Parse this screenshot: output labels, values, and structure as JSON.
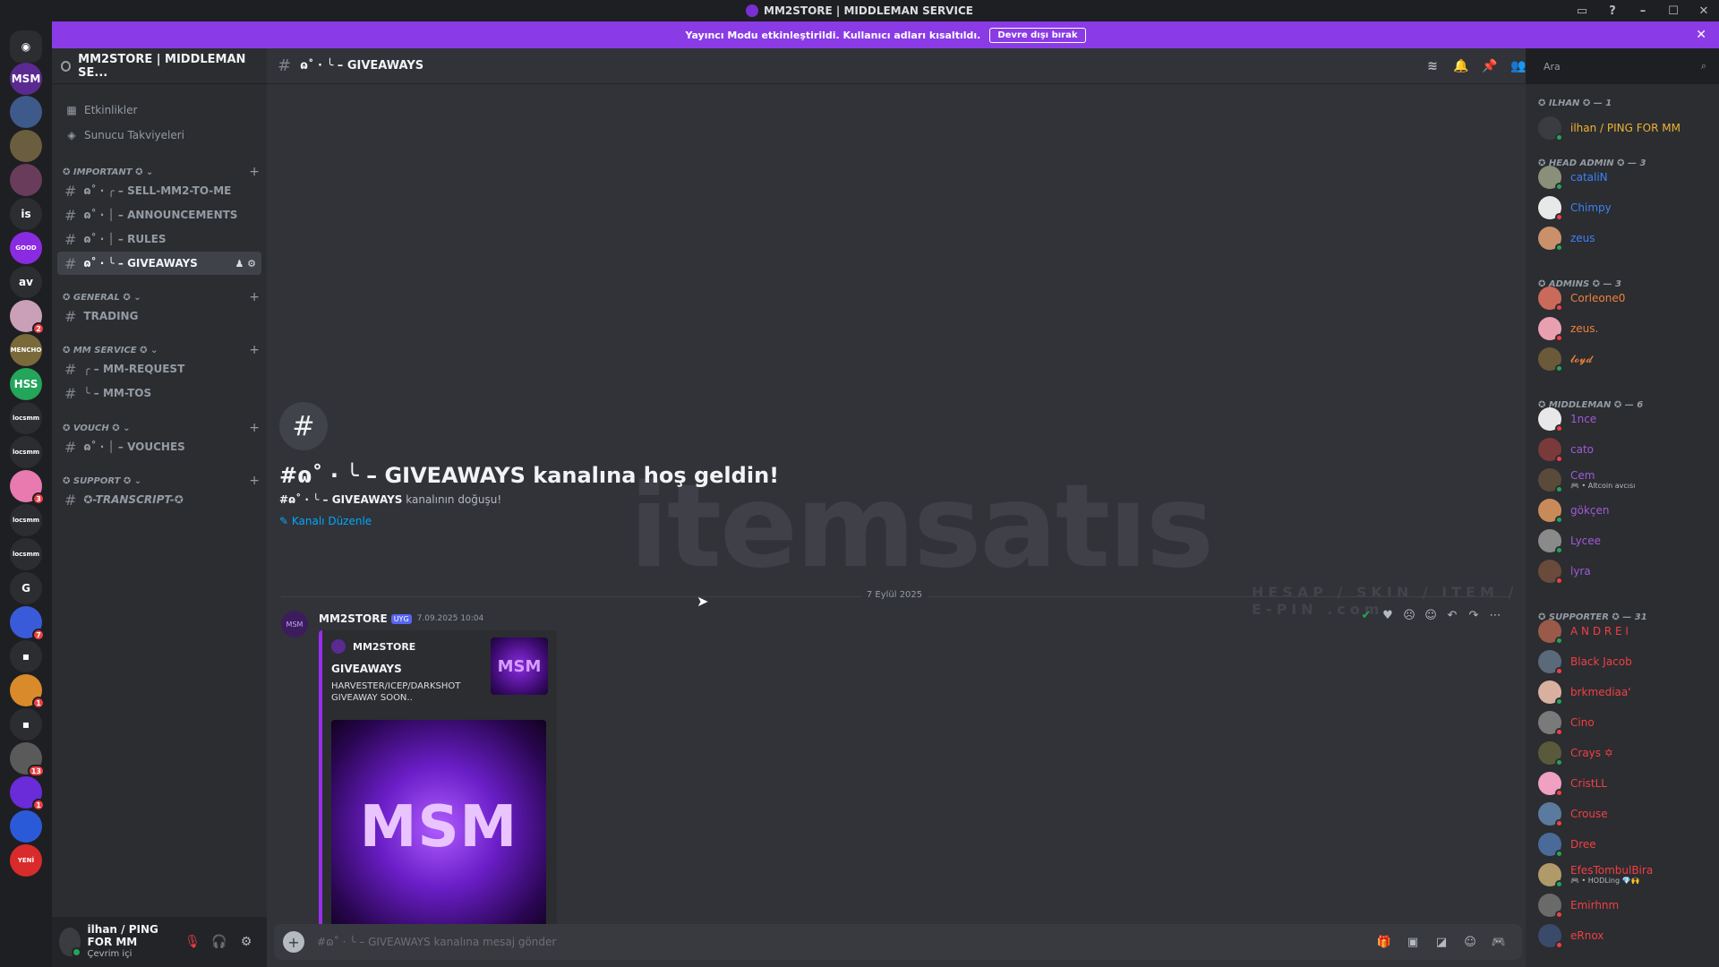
{
  "titlebar": {
    "title": "MM2STORE | MIDDLEMAN SERVICE",
    "minimize": "–",
    "maximize": "☐",
    "close": "✕"
  },
  "banner": {
    "text": "Yayıncı Modu etkinleştirildi. Kullanıcı adları kısaltıldı.",
    "button": "Devre dışı bırak",
    "close": "✕"
  },
  "guilds": [
    {
      "label": "MSM",
      "bg": "#5b2a91",
      "badge": ""
    },
    {
      "label": "",
      "bg": "#3d5a8a",
      "badge": ""
    },
    {
      "label": "",
      "bg": "#6b5e3e",
      "badge": ""
    },
    {
      "label": "",
      "bg": "#6a3c5c",
      "badge": ""
    },
    {
      "label": "is",
      "bg": "#2b2d31",
      "badge": ""
    },
    {
      "label": "GOOD",
      "bg": "#8a2be2",
      "badge": ""
    },
    {
      "label": "av",
      "bg": "#2b2d31",
      "badge": ""
    },
    {
      "label": "",
      "bg": "#c9a0b8",
      "badge": "2"
    },
    {
      "label": "MENCHO",
      "bg": "#7a6a3a",
      "badge": ""
    },
    {
      "label": "HSS",
      "bg": "#23a55a",
      "badge": ""
    },
    {
      "label": "locsmm",
      "bg": "#2b2d31",
      "badge": ""
    },
    {
      "label": "locsmm",
      "bg": "#2b2d31",
      "badge": ""
    },
    {
      "label": "",
      "bg": "#e87ab0",
      "badge": "3"
    },
    {
      "label": "locsmm",
      "bg": "#2b2d31",
      "badge": ""
    },
    {
      "label": "locsmm",
      "bg": "#2b2d31",
      "badge": ""
    },
    {
      "label": "G",
      "bg": "#2b2d31",
      "badge": ""
    },
    {
      "label": "",
      "bg": "#3a5bd9",
      "badge": "7"
    },
    {
      "label": "▪",
      "bg": "#2b2d31",
      "badge": ""
    },
    {
      "label": "",
      "bg": "#d98a2b",
      "badge": "1"
    },
    {
      "label": "▪",
      "bg": "#2b2d31",
      "badge": ""
    },
    {
      "label": "",
      "bg": "#5a5a5a",
      "badge": "13"
    },
    {
      "label": "",
      "bg": "#6a2bd9",
      "badge": "1"
    },
    {
      "label": "",
      "bg": "#2b5ad9",
      "badge": ""
    },
    {
      "label": "YENİ",
      "bg": "#d92b2b",
      "badge": ""
    }
  ],
  "server": {
    "name": "MM2STORE | MIDDLEMAN SE...",
    "chev": "⌄"
  },
  "sidebar": {
    "events": "Etkinlikler",
    "boosts": "Sunucu Takviyeleri",
    "categories": [
      {
        "name": "✪ IMPORTANT ✪ ⌄",
        "plus": "+"
      },
      {
        "name": "✪ GENERAL ✪ ⌄",
        "plus": "+"
      },
      {
        "name": "✪ MM SERVICE ✪ ⌄",
        "plus": "+"
      },
      {
        "name": "✪ VOUCH ✪ ⌄",
        "plus": "+"
      },
      {
        "name": "✪ SUPPORT ✪ ⌄",
        "plus": "+"
      }
    ],
    "channels": [
      "ɷ˚ · ╭ – SELL-MM2-TO-ME",
      "ɷ˚ · │ – ANNOUNCEMENTS",
      "ɷ˚ · │ – RULES",
      "ɷ˚ · ╰ – GIVEAWAYS",
      "TRADING",
      "╭ – MM-REQUEST",
      "╰ – MM-TOS",
      "ɷ˚ · │ – VOUCHES",
      "✪-TRANSCRIPT-✪"
    ]
  },
  "user": {
    "name": "ilhan / PING FOR MM",
    "status": "Çevrim içi"
  },
  "header": {
    "channel": "ɷ˚ · ╰ – GIVEAWAYS"
  },
  "search": {
    "placeholder": "Ara"
  },
  "welcome": {
    "title": "#ɷ˚ · ╰ – GIVEAWAYS kanalına hoş geldin!",
    "sub_channel": "#ɷ˚ · ╰ – GIVEAWAYS",
    "sub_rest": " kanalının doğuşu!",
    "edit": "✎ Kanalı Düzenle"
  },
  "watermark": {
    "text": "itemsatıs",
    "sub": "HESAP / SKIN / ITEM / E-PIN .com"
  },
  "divider": {
    "date": "7 Eylül 2025"
  },
  "message": {
    "author": "MM2STORE",
    "tag": "UYG",
    "time": "7.09.2025 10:04",
    "embed": {
      "author": "MM2STORE",
      "title": "GIVEAWAYS",
      "desc": "HARVESTER/ICEP/DARKSHOT GIVEAWAY SOON..",
      "thumb": "MSM",
      "image": "MSM",
      "color": "#9b2cf0"
    }
  },
  "composer": {
    "placeholder": "#ɷ˚ · ╰ – GIVEAWAYS kanalına mesaj gönder"
  },
  "members": {
    "groups": [
      {
        "name": "✪ ILHAN ✪ — 1"
      },
      {
        "name": "✪ HEAD ADMIN ✪ — 3"
      },
      {
        "name": "✪ ADMINS ✪ — 3"
      },
      {
        "name": "✪ MIDDLEMAN ✪ — 6"
      },
      {
        "name": "✪ SUPPORTER ✪ — 31"
      }
    ],
    "list": [
      {
        "name": "ilhan / PING FOR MM",
        "color": "#f0b232",
        "status": "#23a55a",
        "av": "#3a3c42",
        "activity": ""
      },
      {
        "name": "cataliN",
        "color": "#3b82f6",
        "status": "#23a55a",
        "av": "#8a8f7a",
        "activity": ""
      },
      {
        "name": "Chimpy",
        "color": "#3b82f6",
        "status": "#f23f43",
        "av": "#e8e8e8",
        "activity": ""
      },
      {
        "name": "zeus",
        "color": "#3b82f6",
        "status": "#23a55a",
        "av": "#c9906a",
        "activity": ""
      },
      {
        "name": "Corleone0",
        "color": "#f0813b",
        "status": "#f23f43",
        "av": "#c96a5a",
        "activity": ""
      },
      {
        "name": "zeus.",
        "color": "#f0813b",
        "status": "#f23f43",
        "av": "#e8a0b0",
        "activity": ""
      },
      {
        "name": "𝓵𝓸𝔂𝓭",
        "color": "#f0813b",
        "status": "#23a55a",
        "av": "#6a5a3a",
        "activity": ""
      },
      {
        "name": "1nce",
        "color": "#a05ad9",
        "status": "#f23f43",
        "av": "#e8e8e8",
        "activity": ""
      },
      {
        "name": "cato",
        "color": "#a05ad9",
        "status": "#f23f43",
        "av": "#7a3a3a",
        "activity": ""
      },
      {
        "name": "Cem",
        "color": "#a05ad9",
        "status": "#23a55a",
        "av": "#5a4a3a",
        "activity": "🎮 • Altcoin avcısı"
      },
      {
        "name": "gökçen",
        "color": "#a05ad9",
        "status": "#23a55a",
        "av": "#c98a5a",
        "activity": ""
      },
      {
        "name": "Lycee",
        "color": "#a05ad9",
        "status": "#23a55a",
        "av": "#8a8a8a",
        "activity": ""
      },
      {
        "name": "lyra",
        "color": "#a05ad9",
        "status": "#f23f43",
        "av": "#6a4a3a",
        "activity": ""
      },
      {
        "name": "A N D R E I",
        "color": "#f23f43",
        "status": "#23a55a",
        "av": "#9a5a4a",
        "activity": ""
      },
      {
        "name": "Black Jacob",
        "color": "#f23f43",
        "status": "#f23f43",
        "av": "#5a6a7a",
        "activity": ""
      },
      {
        "name": "brkmediaa'",
        "color": "#f23f43",
        "status": "#23a55a",
        "av": "#d9b0a0",
        "activity": ""
      },
      {
        "name": "Cino",
        "color": "#f23f43",
        "status": "#f23f43",
        "av": "#7a7a7a",
        "activity": ""
      },
      {
        "name": "Crays ✡",
        "color": "#f23f43",
        "status": "#23a55a",
        "av": "#5a5a3a",
        "activity": ""
      },
      {
        "name": "CristLL",
        "color": "#f23f43",
        "status": "#f23f43",
        "av": "#f0a0c0",
        "activity": ""
      },
      {
        "name": "Crouse",
        "color": "#f23f43",
        "status": "#f23f43",
        "av": "#5a7aa0",
        "activity": ""
      },
      {
        "name": "Dree",
        "color": "#f23f43",
        "status": "#23a55a",
        "av": "#4a6a9a",
        "activity": ""
      },
      {
        "name": "EfesTombulBira",
        "color": "#f23f43",
        "status": "#23a55a",
        "av": "#b09a6a",
        "activity": "🎮 • HODLing 💎🙌"
      },
      {
        "name": "Emirhnm",
        "color": "#f23f43",
        "status": "#f23f43",
        "av": "#6a6a6a",
        "activity": ""
      },
      {
        "name": "eRnox",
        "color": "#f23f43",
        "status": "#f23f43",
        "av": "#3a4a6a",
        "activity": ""
      }
    ]
  }
}
